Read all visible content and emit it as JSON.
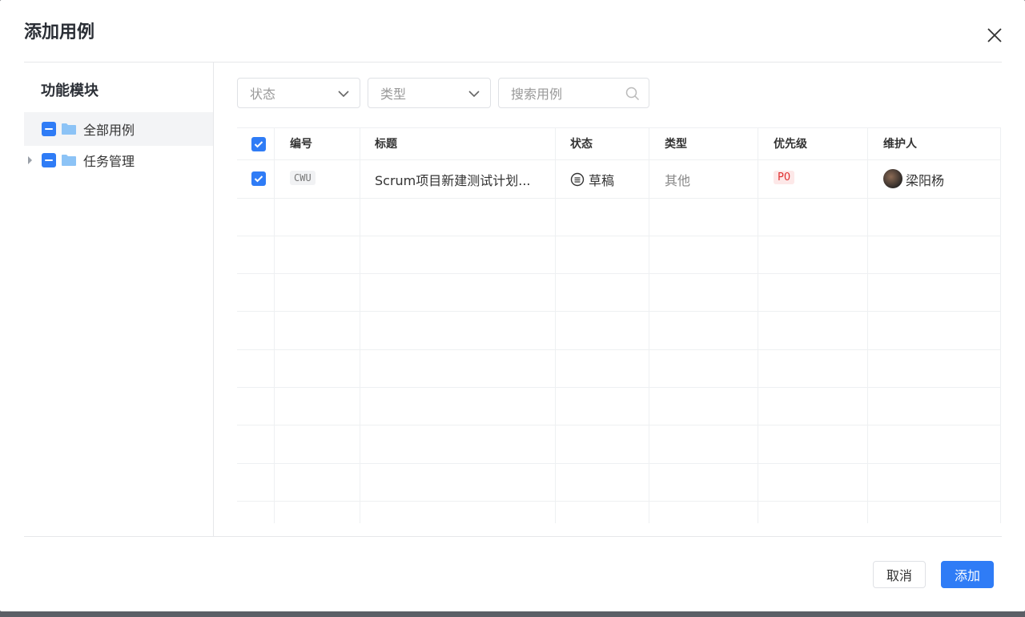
{
  "dialog": {
    "title": "添加用例",
    "close_icon": "close-icon"
  },
  "sidebar": {
    "title": "功能模块",
    "items": [
      {
        "label": "全部用例",
        "selected": true,
        "expandable": false
      },
      {
        "label": "任务管理",
        "selected": false,
        "expandable": true
      }
    ]
  },
  "filters": {
    "status_placeholder": "状态",
    "type_placeholder": "类型",
    "search_placeholder": "搜索用例"
  },
  "table": {
    "columns": [
      "编号",
      "标题",
      "状态",
      "类型",
      "优先级",
      "维护人"
    ],
    "rows": [
      {
        "checked": true,
        "code": "CWU",
        "title": "Scrum项目新建测试计划...",
        "status": "草稿",
        "type": "其他",
        "priority": "P0",
        "maintainer": "梁阳杨"
      }
    ]
  },
  "footer": {
    "cancel_label": "取消",
    "confirm_label": "添加"
  },
  "colors": {
    "accent": "#2f7cf6",
    "priority_p0": "#e02e2e"
  }
}
